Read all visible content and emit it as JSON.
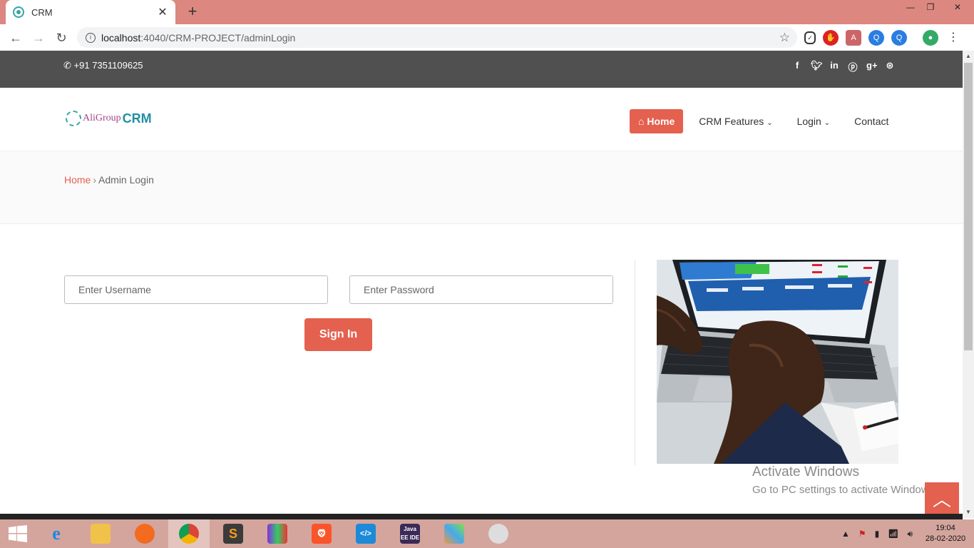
{
  "browser": {
    "tab_title": "CRM",
    "url_host": "localhost",
    "url_path": ":4040/CRM-PROJECT/adminLogin"
  },
  "topbar": {
    "phone": "+91 7351109625",
    "social_icons": [
      "facebook-icon",
      "twitter-icon",
      "linkedin-icon",
      "pinterest-icon",
      "google-plus-icon",
      "dribbble-icon"
    ]
  },
  "header": {
    "logo_part1": "AliGroup",
    "logo_part2": "CRM",
    "menu": {
      "home": "Home",
      "features": "CRM Features",
      "login": "Login",
      "contact": "Contact"
    }
  },
  "breadcrumb": {
    "home": "Home",
    "separator": "›",
    "current": "Admin Login"
  },
  "login_form": {
    "username_placeholder": "Enter Username",
    "password_placeholder": "Enter Password",
    "submit_label": "Sign In"
  },
  "watermark": {
    "line1": "Activate Windows",
    "line2": "Go to PC settings to activate Windows."
  },
  "taskbar": {
    "time": "19:04",
    "date": "28-02-2020",
    "apps": [
      "Internet Explorer",
      "File Explorer",
      "Firefox",
      "Chrome",
      "Sublime Text",
      "WinRAR",
      "Brave",
      "VS Code",
      "Java EE IDE",
      "Photos",
      "Paint"
    ]
  },
  "colors": {
    "accent": "#e4604f",
    "topbar_bg": "#505050",
    "logo_purple": "#a3448a",
    "logo_teal": "#1f8fa3"
  }
}
